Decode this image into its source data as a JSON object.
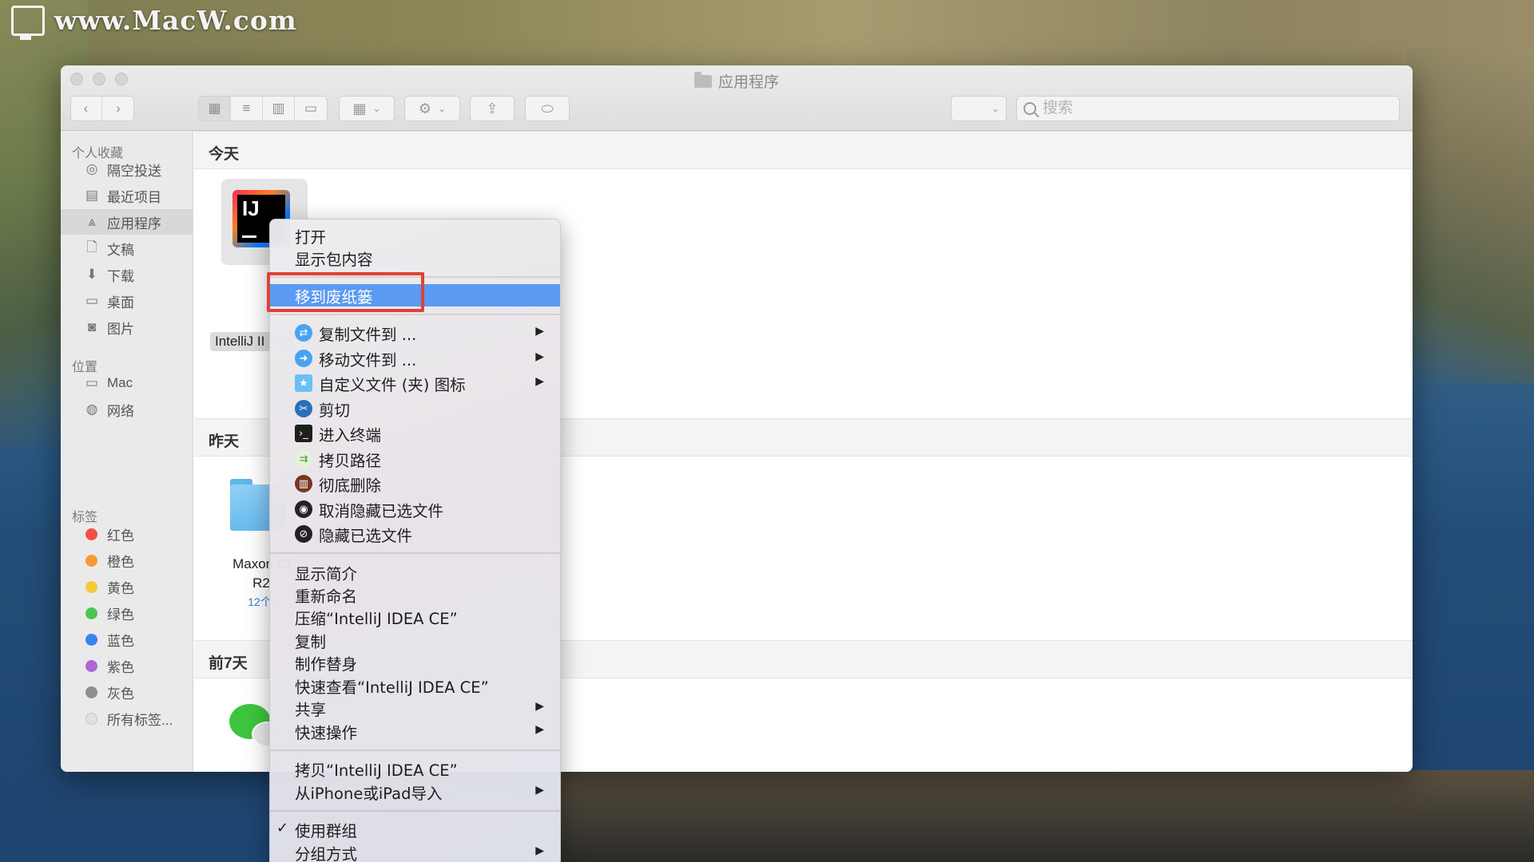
{
  "watermark": {
    "text": "www.MacW.com"
  },
  "window": {
    "title": "应用程序",
    "search_placeholder": "搜索",
    "toolbar": {
      "back_icon": "chevron-left-icon",
      "forward_icon": "chevron-right-icon",
      "view_modes": [
        "icon-view",
        "list-view",
        "column-view",
        "gallery-view"
      ],
      "group_icon": "group-by-icon",
      "action_icon": "gear-icon",
      "share_icon": "share-icon",
      "tag_icon": "tag-icon"
    }
  },
  "sidebar": {
    "favorites_head": "个人收藏",
    "favorites": [
      {
        "label": "隔空投送",
        "icon": "airdrop-icon"
      },
      {
        "label": "最近项目",
        "icon": "recents-icon"
      },
      {
        "label": "应用程序",
        "icon": "applications-icon",
        "selected": true
      },
      {
        "label": "文稿",
        "icon": "document-icon"
      },
      {
        "label": "下载",
        "icon": "download-icon"
      },
      {
        "label": "桌面",
        "icon": "desktop-icon"
      },
      {
        "label": "图片",
        "icon": "camera-icon"
      }
    ],
    "locations_head": "位置",
    "locations": [
      {
        "label": "Mac",
        "icon": "computer-icon"
      },
      {
        "label": "网络",
        "icon": "network-icon"
      }
    ],
    "tags_head": "标签",
    "tags": [
      {
        "label": "红色",
        "color": "#f24f47"
      },
      {
        "label": "橙色",
        "color": "#f59a33"
      },
      {
        "label": "黄色",
        "color": "#f5c933"
      },
      {
        "label": "绿色",
        "color": "#4cc552"
      },
      {
        "label": "蓝色",
        "color": "#3a82f0"
      },
      {
        "label": "紫色",
        "color": "#b166d6"
      },
      {
        "label": "灰色",
        "color": "#8e8e8e"
      },
      {
        "label": "所有标签...",
        "color": "#e0e0e0"
      }
    ]
  },
  "content": {
    "groups": [
      {
        "title": "今天"
      },
      {
        "title": "昨天"
      },
      {
        "title": "前7天"
      }
    ],
    "files": {
      "intellij": "IntelliJ II",
      "maxon_line1": "Maxon Ci",
      "maxon_line2": "R2",
      "maxon_meta": "12个I",
      "wechat": "微信"
    }
  },
  "context_menu": {
    "items": [
      {
        "label": "打开"
      },
      {
        "label": "显示包内容"
      },
      {
        "label": "移到废纸篓",
        "selected": true
      },
      {
        "label": "复制文件到 ...",
        "icon_color": "#4aa3f0",
        "submenu": true
      },
      {
        "label": "移动文件到 ...",
        "icon_color": "#4aa3f0",
        "submenu": true
      },
      {
        "label": "自定义文件 (夹) 图标",
        "icon_color": "#69c0f5",
        "submenu": true
      },
      {
        "label": "剪切",
        "icon_color": "#2a6fb8"
      },
      {
        "label": "进入终端",
        "icon_color": "#1e1e1e"
      },
      {
        "label": "拷贝路径",
        "icon_color": "#e6f2dc"
      },
      {
        "label": "彻底删除",
        "icon_color": "#7a3520"
      },
      {
        "label": "取消隐藏已选文件",
        "icon_color": "#222222"
      },
      {
        "label": "隐藏已选文件",
        "icon_color": "#222222"
      },
      {
        "label": "显示简介"
      },
      {
        "label": "重新命名"
      },
      {
        "label": "压缩“IntelliJ IDEA CE”"
      },
      {
        "label": "复制"
      },
      {
        "label": "制作替身"
      },
      {
        "label": "快速查看“IntelliJ IDEA CE”"
      },
      {
        "label": "共享",
        "submenu": true
      },
      {
        "label": "快速操作",
        "submenu": true
      },
      {
        "label": "拷贝“IntelliJ IDEA CE”"
      },
      {
        "label": "从iPhone或iPad导入",
        "submenu": true
      },
      {
        "label": "使用群组",
        "checked": true
      },
      {
        "label": "分组方式",
        "submenu": true
      }
    ],
    "submenu_arrow": "▶",
    "check_mark": "✓"
  }
}
